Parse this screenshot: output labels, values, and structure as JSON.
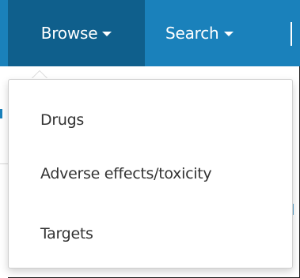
{
  "navbar": {
    "browse_label": "Browse",
    "search_label": "Search",
    "color": "#1a81bb",
    "active_color": "#0f5f8c"
  },
  "browse_menu": {
    "items": [
      {
        "label": "Drugs"
      },
      {
        "label": "Adverse effects/toxicity"
      },
      {
        "label": "Targets"
      }
    ]
  }
}
